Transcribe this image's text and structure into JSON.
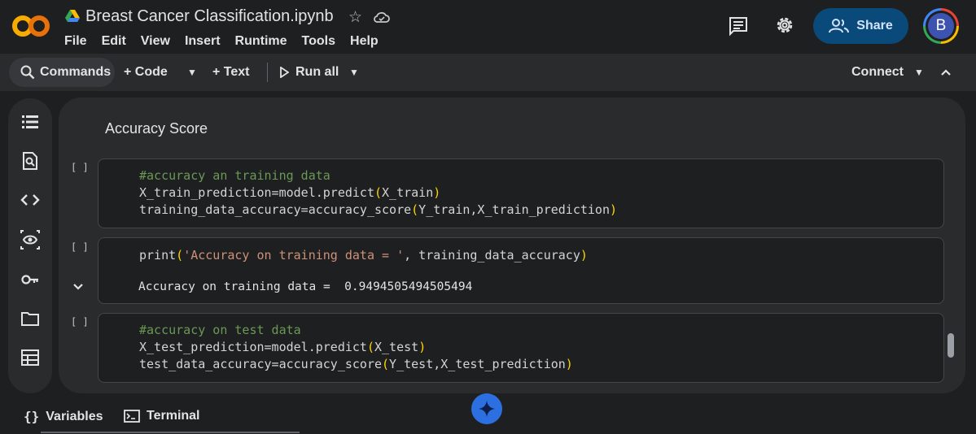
{
  "app": {
    "logo_text": "CO",
    "notebook_title": "Breast Cancer Classification.ipynb"
  },
  "menu": [
    "File",
    "Edit",
    "View",
    "Insert",
    "Runtime",
    "Tools",
    "Help"
  ],
  "header": {
    "share_label": "Share",
    "avatar_letter": "B"
  },
  "toolbar": {
    "commands_label": "Commands",
    "code_label": "+ Code",
    "text_label": "+ Text",
    "run_all_label": "Run all",
    "connect_label": "Connect"
  },
  "sidebar_icons": [
    "table-of-contents-icon",
    "find-replace-icon",
    "code-snippets-icon",
    "variable-inspector-icon",
    "secrets-key-icon",
    "files-folder-icon",
    "data-table-icon"
  ],
  "notebook": {
    "section_heading": "Accuracy Score",
    "cells": [
      {
        "run_indicator": "[ ]",
        "code": [
          "#accuracy an training data",
          "X_train_prediction=model.predict(X_train)",
          "training_data_accuracy=accuracy_score(Y_train,X_train_prediction)"
        ]
      },
      {
        "run_indicator": "[ ]",
        "code": [
          "print('Accuracy on training data = ', training_data_accuracy)"
        ],
        "output": "Accuracy on training data =  0.9494505494505494"
      },
      {
        "run_indicator": "[ ]",
        "code": [
          "#accuracy on test data",
          "X_test_prediction=model.predict(X_test)",
          "test_data_accuracy=accuracy_score(Y_test,X_test_prediction)"
        ]
      }
    ]
  },
  "bottom_bar": {
    "variables_label": "Variables",
    "terminal_label": "Terminal"
  },
  "colors": {
    "background": "#1e1f20",
    "panel": "#2a2b2d",
    "share_button": "#0a4a7a",
    "comment": "#6a9955",
    "string": "#ce9178",
    "bracket": "#ffd700",
    "gemini": "#2b6fe0"
  }
}
